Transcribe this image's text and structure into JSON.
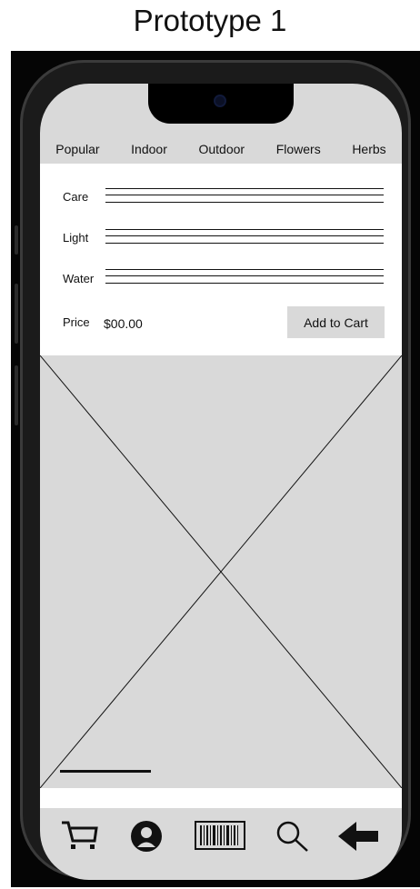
{
  "page": {
    "title": "Prototype 1"
  },
  "categories": [
    "Popular",
    "Indoor",
    "Outdoor",
    "Flowers",
    "Herbs"
  ],
  "details": {
    "care_label": "Care",
    "light_label": "Light",
    "water_label": "Water",
    "price_label": "Price",
    "price_value": "$00.00",
    "add_to_cart_label": "Add to Cart"
  },
  "bottom_nav": {
    "items": [
      {
        "name": "cart-icon"
      },
      {
        "name": "user-icon"
      },
      {
        "name": "barcode-icon"
      },
      {
        "name": "search-icon"
      },
      {
        "name": "back-arrow-icon"
      }
    ]
  },
  "colors": {
    "placeholder_gray": "#d9d9d9",
    "device_frame": "#1b1b1b",
    "text": "#111111"
  }
}
